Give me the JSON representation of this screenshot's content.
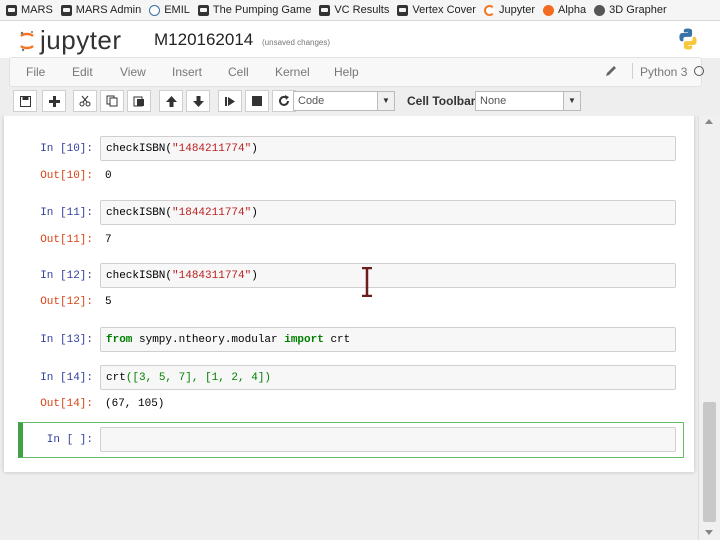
{
  "bookmarks": [
    {
      "label": "MARS",
      "icon": "car-icon"
    },
    {
      "label": "MARS Admin",
      "icon": "car-icon"
    },
    {
      "label": "EMIL",
      "icon": "emil-icon"
    },
    {
      "label": "The Pumping Game",
      "icon": "car-icon"
    },
    {
      "label": "VC Results",
      "icon": "car-icon"
    },
    {
      "label": "Vertex Cover",
      "icon": "car-icon"
    },
    {
      "label": "Jupyter",
      "icon": "jupyter-icon"
    },
    {
      "label": "Alpha",
      "icon": "alpha-icon"
    },
    {
      "label": "3D Grapher",
      "icon": "grapher-icon"
    }
  ],
  "header": {
    "logo_text": "jupyter",
    "notebook_name": "M120162014",
    "save_status": "(unsaved changes)"
  },
  "menu": {
    "items": [
      "File",
      "Edit",
      "View",
      "Insert",
      "Cell",
      "Kernel",
      "Help"
    ],
    "kernel_name": "Python 3"
  },
  "toolbar": {
    "cell_type": "Code",
    "cell_toolbar_label": "Cell Toolbar:",
    "cell_toolbar_value": "None"
  },
  "cells": [
    {
      "in_prompt": "In [10]:",
      "code": {
        "fn": "checkISBN(",
        "str": "\"1484211774\"",
        "end": ")"
      },
      "out_prompt": "Out[10]:",
      "output": "0"
    },
    {
      "in_prompt": "In [11]:",
      "code": {
        "fn": "checkISBN(",
        "str": "\"1844211774\"",
        "end": ")"
      },
      "out_prompt": "Out[11]:",
      "output": "7"
    },
    {
      "in_prompt": "In [12]:",
      "code": {
        "fn": "checkISBN(",
        "str": "\"1484311774\"",
        "end": ")"
      },
      "out_prompt": "Out[12]:",
      "output": "5"
    },
    {
      "in_prompt": "In [13]:",
      "code": {
        "kw1": "from",
        "mid": " sympy.ntheory.modular ",
        "kw2": "import",
        "end": " crt"
      }
    },
    {
      "in_prompt": "In [14]:",
      "code": {
        "fn": "crt",
        "rest": "([3, 5, 7], [1, 2, 4])"
      },
      "out_prompt": "Out[14]:",
      "output": "(67, 105)"
    },
    {
      "in_prompt": "In [ ]:"
    }
  ]
}
